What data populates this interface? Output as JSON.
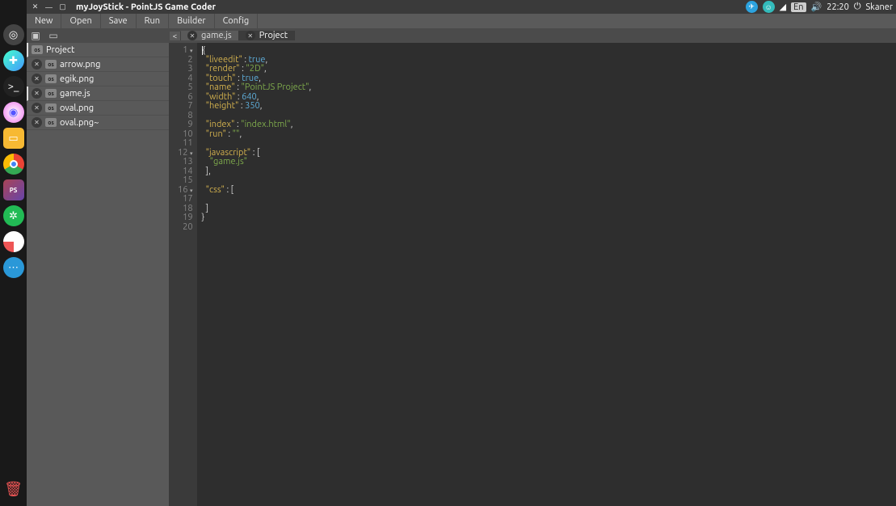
{
  "window": {
    "title": "myJoyStick - PointJS Game Coder"
  },
  "tray": {
    "lang": "En",
    "time": "22:20",
    "user": "Skaner"
  },
  "menu": {
    "items": [
      "New",
      "Open",
      "Save",
      "Run",
      "Builder",
      "Config"
    ]
  },
  "sidebar": {
    "items": [
      {
        "label": "Project",
        "root": true,
        "selected": true
      },
      {
        "label": "arrow.png"
      },
      {
        "label": "egik.png"
      },
      {
        "label": "game.js",
        "selected": true
      },
      {
        "label": "oval.png"
      },
      {
        "label": "oval.png~"
      }
    ]
  },
  "badge_text": "os",
  "tabs": {
    "left_icon": "<",
    "items": [
      {
        "label": "game.js",
        "active": false
      },
      {
        "label": "Project",
        "active": true
      }
    ]
  },
  "editor": {
    "lines": 20,
    "folds": {
      "1": true,
      "12": true,
      "16": true
    },
    "code": [
      {
        "n": 1,
        "tokens": [
          {
            "t": "{",
            "c": "punc"
          }
        ]
      },
      {
        "n": 2,
        "tokens": [
          {
            "t": "  ",
            "c": "punc"
          },
          {
            "t": "\"liveedit\"",
            "c": "key"
          },
          {
            "t": " : ",
            "c": "punc"
          },
          {
            "t": "true",
            "c": "bool"
          },
          {
            "t": ",",
            "c": "punc"
          }
        ]
      },
      {
        "n": 3,
        "tokens": [
          {
            "t": "  ",
            "c": "punc"
          },
          {
            "t": "\"render\"",
            "c": "key"
          },
          {
            "t": " : ",
            "c": "punc"
          },
          {
            "t": "\"2D\"",
            "c": "str"
          },
          {
            "t": ",",
            "c": "punc"
          }
        ]
      },
      {
        "n": 4,
        "tokens": [
          {
            "t": "  ",
            "c": "punc"
          },
          {
            "t": "\"touch\"",
            "c": "key"
          },
          {
            "t": " : ",
            "c": "punc"
          },
          {
            "t": "true",
            "c": "bool"
          },
          {
            "t": ",",
            "c": "punc"
          }
        ]
      },
      {
        "n": 5,
        "tokens": [
          {
            "t": "  ",
            "c": "punc"
          },
          {
            "t": "\"name\"",
            "c": "key"
          },
          {
            "t": " : ",
            "c": "punc"
          },
          {
            "t": "\"PointJS Project\"",
            "c": "str"
          },
          {
            "t": ",",
            "c": "punc"
          }
        ]
      },
      {
        "n": 6,
        "tokens": [
          {
            "t": "  ",
            "c": "punc"
          },
          {
            "t": "\"width\"",
            "c": "key"
          },
          {
            "t": " : ",
            "c": "punc"
          },
          {
            "t": "640",
            "c": "num"
          },
          {
            "t": ",",
            "c": "punc"
          }
        ]
      },
      {
        "n": 7,
        "tokens": [
          {
            "t": "  ",
            "c": "punc"
          },
          {
            "t": "\"height\"",
            "c": "key"
          },
          {
            "t": " : ",
            "c": "punc"
          },
          {
            "t": "350",
            "c": "num"
          },
          {
            "t": ",",
            "c": "punc"
          }
        ]
      },
      {
        "n": 8,
        "tokens": []
      },
      {
        "n": 9,
        "tokens": [
          {
            "t": "  ",
            "c": "punc"
          },
          {
            "t": "\"index\"",
            "c": "key"
          },
          {
            "t": " : ",
            "c": "punc"
          },
          {
            "t": "\"index.html\"",
            "c": "str"
          },
          {
            "t": ",",
            "c": "punc"
          }
        ]
      },
      {
        "n": 10,
        "tokens": [
          {
            "t": "  ",
            "c": "punc"
          },
          {
            "t": "\"run\"",
            "c": "key"
          },
          {
            "t": " : ",
            "c": "punc"
          },
          {
            "t": "\"\"",
            "c": "str"
          },
          {
            "t": ",",
            "c": "punc"
          }
        ]
      },
      {
        "n": 11,
        "tokens": []
      },
      {
        "n": 12,
        "tokens": [
          {
            "t": "  ",
            "c": "punc"
          },
          {
            "t": "\"javascript\"",
            "c": "key"
          },
          {
            "t": " : [",
            "c": "punc"
          }
        ]
      },
      {
        "n": 13,
        "tokens": [
          {
            "t": "    ",
            "c": "punc"
          },
          {
            "t": "\"game.js\"",
            "c": "str"
          }
        ]
      },
      {
        "n": 14,
        "tokens": [
          {
            "t": "  ],",
            "c": "punc"
          }
        ]
      },
      {
        "n": 15,
        "tokens": []
      },
      {
        "n": 16,
        "tokens": [
          {
            "t": "  ",
            "c": "punc"
          },
          {
            "t": "\"css\"",
            "c": "key"
          },
          {
            "t": " : [",
            "c": "punc"
          }
        ]
      },
      {
        "n": 17,
        "tokens": []
      },
      {
        "n": 18,
        "tokens": [
          {
            "t": "  ]",
            "c": "punc"
          }
        ]
      },
      {
        "n": 19,
        "tokens": [
          {
            "t": "}",
            "c": "punc"
          }
        ]
      },
      {
        "n": 20,
        "tokens": []
      }
    ]
  }
}
